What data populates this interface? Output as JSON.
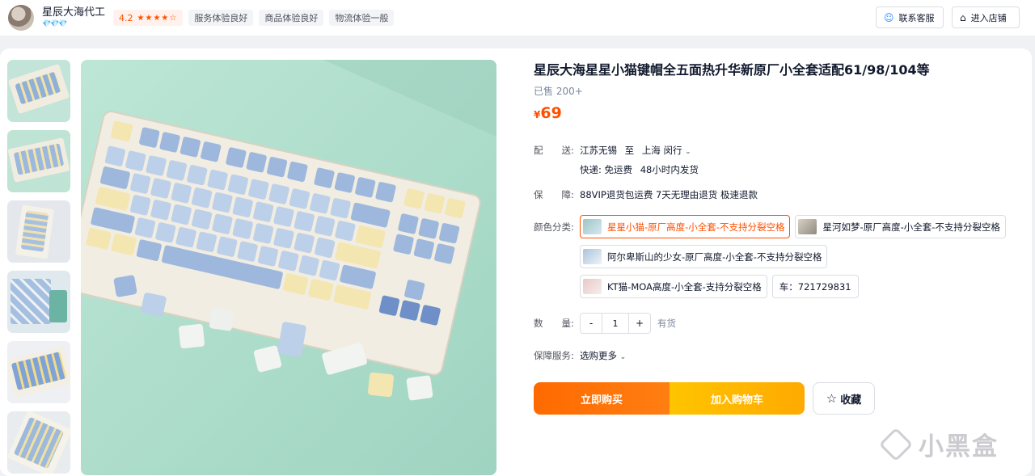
{
  "shop": {
    "name": "星辰大海代工",
    "level": "💎💎💎",
    "rating_score": "4.2",
    "rating_stars": "★★★★☆",
    "tags": [
      "服务体验良好",
      "商品体验良好",
      "物流体验一般"
    ],
    "service_button": "联系客服",
    "store_button": "进入店铺"
  },
  "product": {
    "title": "星辰大海星星小猫键帽全五面热升华新原厂小全套适配61/98/104等",
    "sold": "已售 200+",
    "currency": "¥",
    "price": "69"
  },
  "shipping": {
    "label": "配　　送:",
    "from": "江苏无锡",
    "to_word": "至",
    "to": "上海 闵行",
    "express": "快递: 免运费",
    "dispatch": "48小时内发货"
  },
  "guarantee": {
    "label": "保　　障:",
    "text": "88VIP退货包运费 7天无理由退货 极速退款"
  },
  "color": {
    "label": "颜色分类:",
    "options": [
      {
        "text": "星星小猫-原厂高度-小全套-不支持分裂空格",
        "selected": true,
        "swatch": "#9cc7c2"
      },
      {
        "text": "星河如梦-原厂高度-小全套-不支持分裂空格",
        "selected": false,
        "swatch": "#d8d2c4"
      },
      {
        "text": "阿尔卑斯山的少女-原厂高度-小全套-不支持分裂空格",
        "selected": false,
        "swatch": "#a9c4dd"
      },
      {
        "text": "KT猫-MOA高度-小全套-支持分裂空格",
        "selected": false,
        "swatch": "#e8c8c8"
      },
      {
        "text": "车：721729831",
        "selected": false,
        "swatch": ""
      }
    ]
  },
  "quantity": {
    "label": "数　　量:",
    "minus": "-",
    "value": "1",
    "plus": "+",
    "stock": "有货"
  },
  "service": {
    "label": "保障服务:",
    "value": "选购更多"
  },
  "actions": {
    "buy": "立即购买",
    "cart": "加入购物车",
    "favorite": "收藏"
  },
  "watermark": "小黑盒",
  "colors": {
    "accent": "#ff5000",
    "buy_gradient": "#ff6a00",
    "cart_gradient": "#ffc400",
    "mint_bg": "#a6d8c6"
  }
}
